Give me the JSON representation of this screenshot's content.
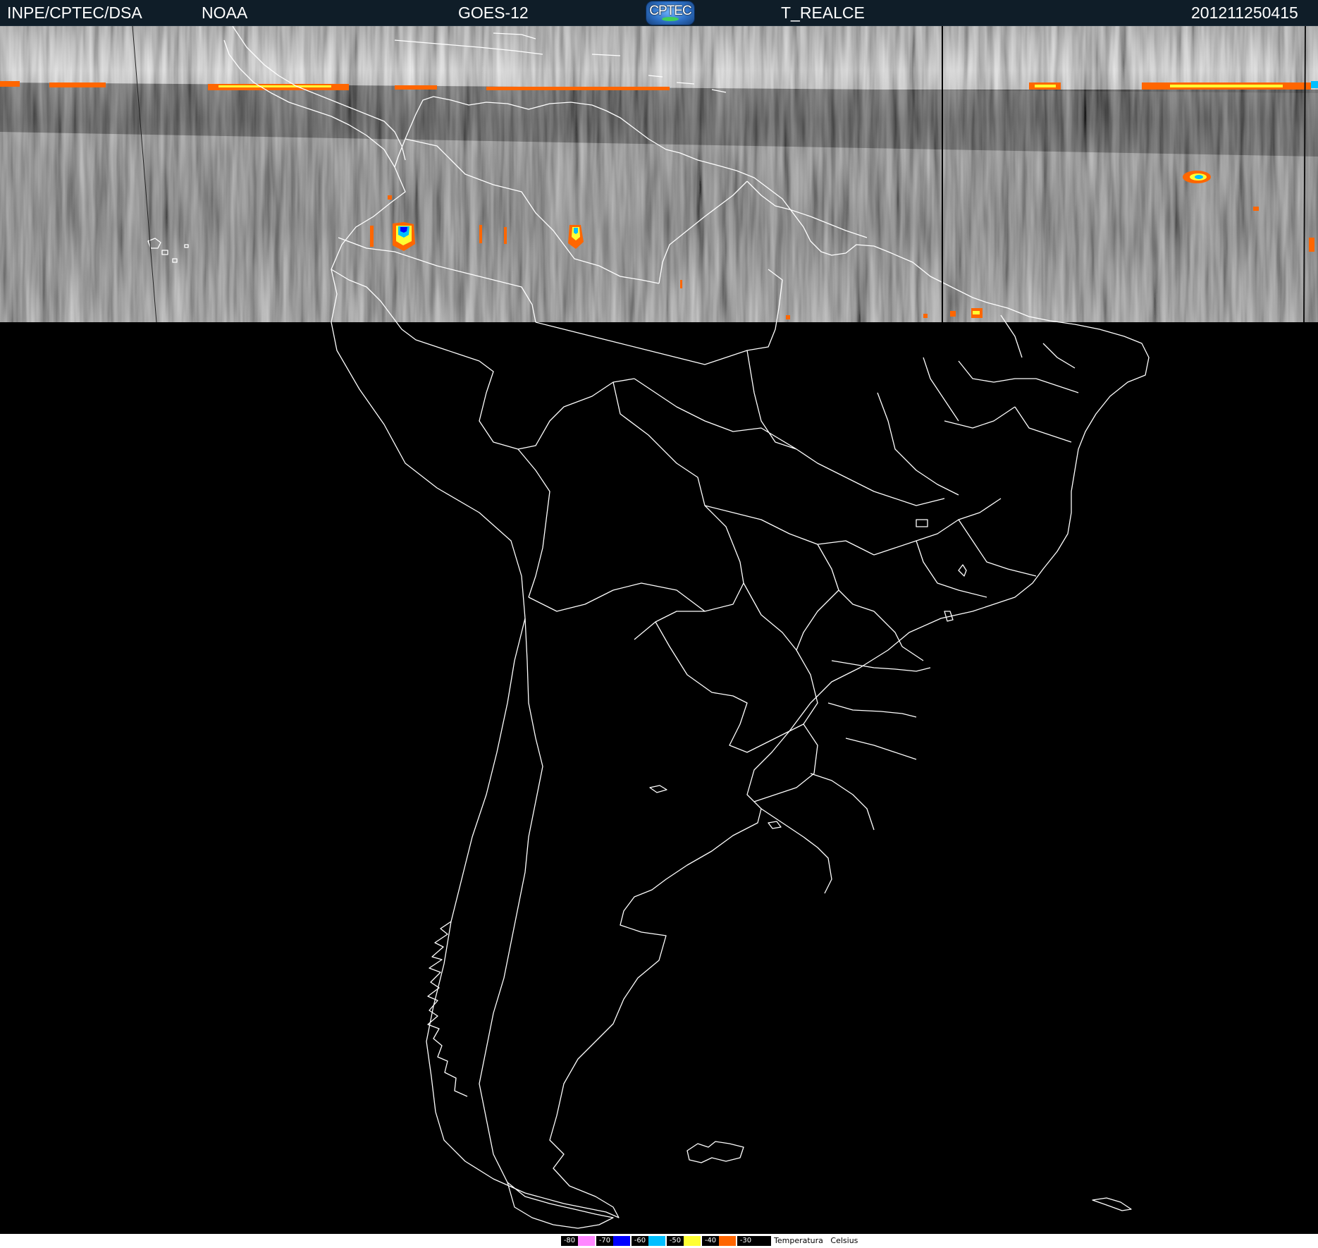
{
  "header": {
    "org": "INPE/CPTEC/DSA",
    "agency": "NOAA",
    "satellite": "GOES-12",
    "logo_text": "CPTEC",
    "product": "T_REALCE",
    "timestamp": "201211250415"
  },
  "legend": {
    "title": "Temperatura",
    "unit": "Celsius",
    "entries": [
      {
        "label": "-80",
        "color": "#ff88ff"
      },
      {
        "label": "-70",
        "color": "#0000ff"
      },
      {
        "label": "-60",
        "color": "#00bfff"
      },
      {
        "label": "-50",
        "color": "#ffff33"
      },
      {
        "label": "-40",
        "color": "#ff6600"
      },
      {
        "label": "-30",
        "color": "#000000"
      }
    ]
  },
  "colors": {
    "header_bg": "#0f1d28",
    "coastline": "#ffffff",
    "background": "#000000"
  }
}
